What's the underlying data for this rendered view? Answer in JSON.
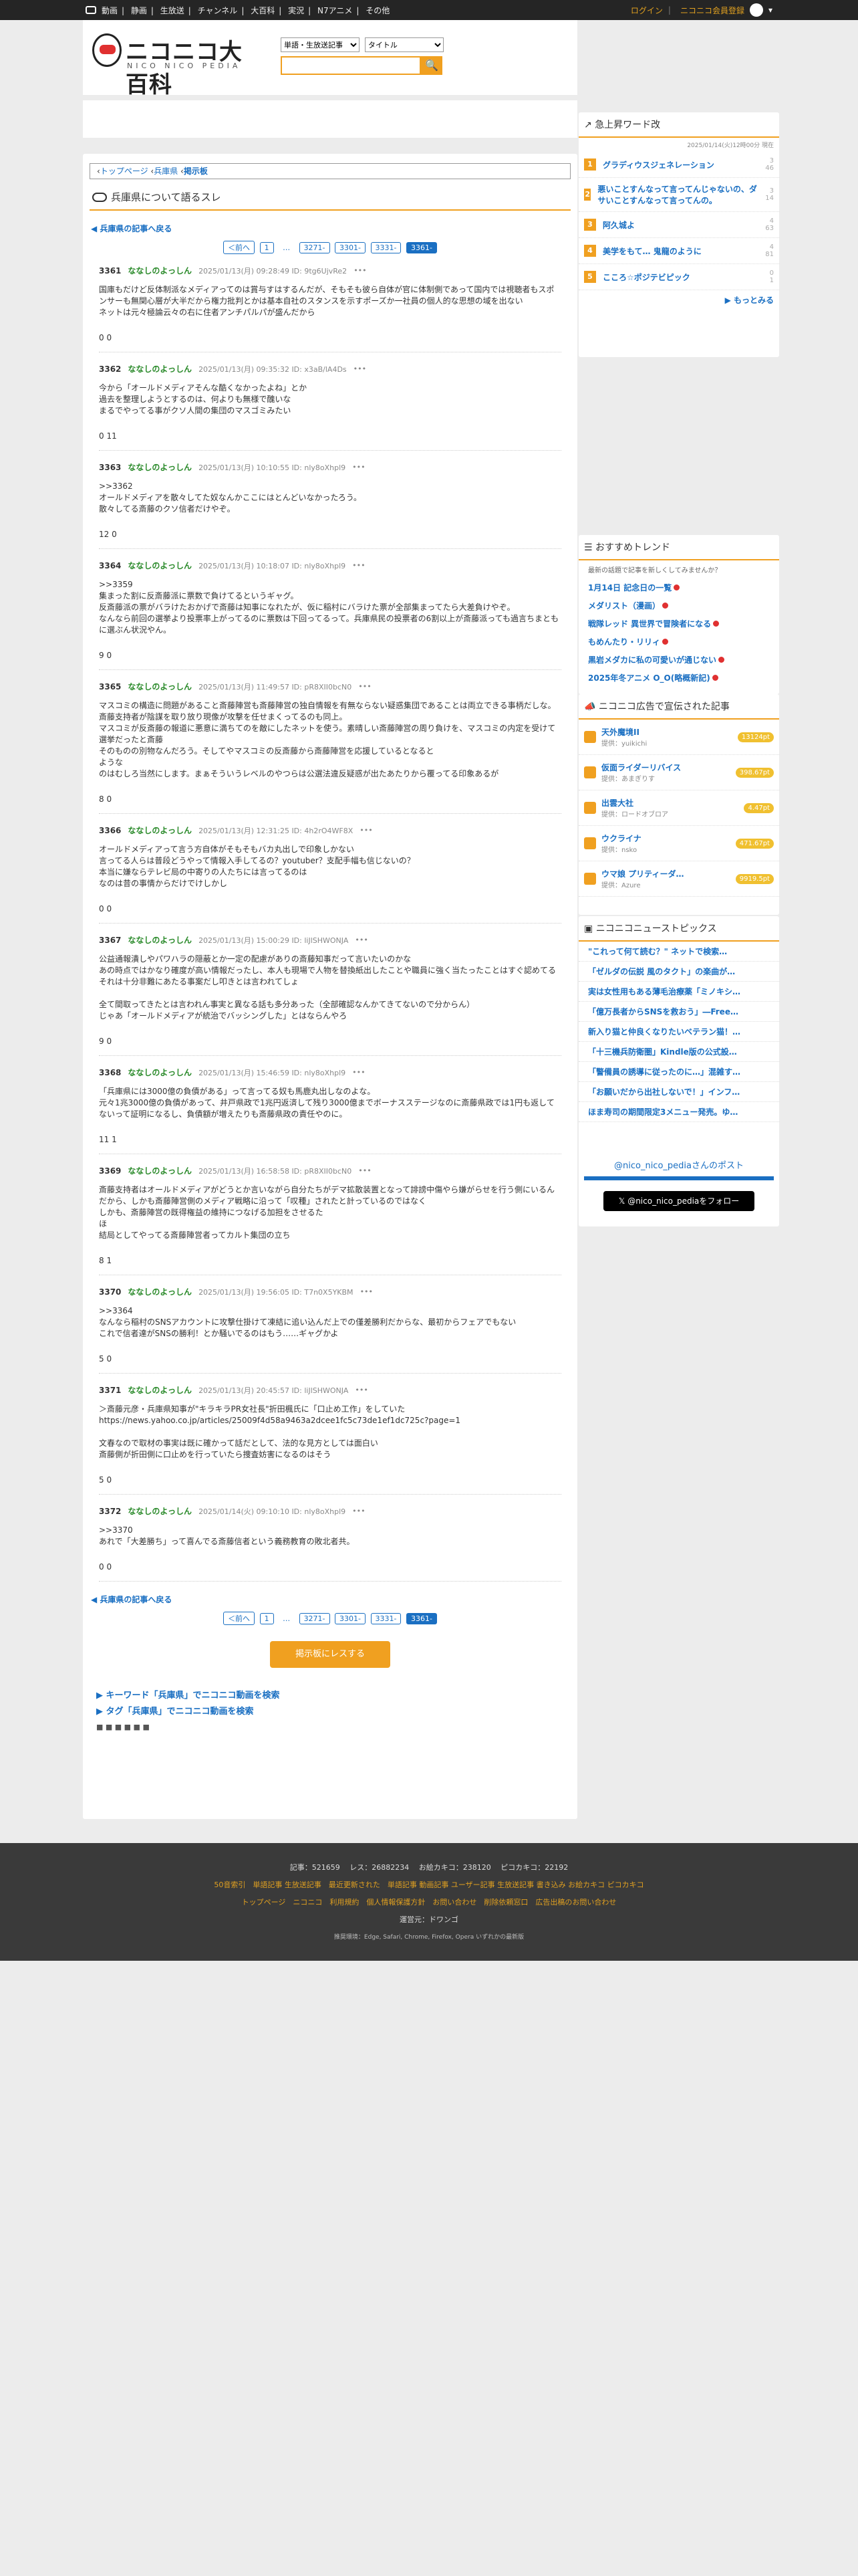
{
  "topbar": {
    "nav": [
      "動画",
      "静画",
      "生放送",
      "チャンネル",
      "大百科",
      "実況",
      "N7アニメ",
      "その他"
    ],
    "login": "ログイン",
    "register": "ニコニコ会員登録"
  },
  "logo": {
    "main": "ニコニコ大百科",
    "sub": "NICO NICO PEDIA"
  },
  "search": {
    "select1": "単語・生放送記事",
    "select2": "タイトル",
    "button": "🔍"
  },
  "breadcrumb": {
    "home": "トップページ",
    "parent": "兵庫県",
    "current": "掲示板"
  },
  "page_title": "兵庫県について語るスレ",
  "back_label": "兵庫県の記事へ戻る",
  "pager": {
    "prev": "＜前へ",
    "first": "1",
    "dots": "…",
    "p1": "3271-",
    "p2": "3301-",
    "p3": "3331-",
    "p4": "3361-"
  },
  "posts": [
    {
      "no": "3361",
      "name": "ななしのよっしん",
      "date": "2025/01/13(月) 09:28:49 ID: 9tg6UjvRe2",
      "body": "国庫もだけど反体制派なメディアってのは賞与すはするんだが、そもそも彼ら自体が官に体制側であって国内では視聴者もスポンサーも無関心層が大半だから権力批判とかは基本自社のスタンスを示すポーズか一社員の個人的な思想の域を出ない\nネットは元々極論云々の右に住者アンチパルパが盛んだから",
      "votes": "0  0"
    },
    {
      "no": "3362",
      "name": "ななしのよっしん",
      "date": "2025/01/13(月) 09:35:32 ID: x3aB/lA4Ds",
      "body": "今から「オールドメディアそんな酷くなかったよね」とか\n過去を整理しようとするのは、何よりも無様で醜いな\nまるでやってる事がクソ人間の集団のマスゴミみたい",
      "votes": "0  11"
    },
    {
      "no": "3363",
      "name": "ななしのよっしん",
      "date": "2025/01/13(月) 10:10:55 ID: nly8oXhpl9",
      "body": ">>3362\nオールドメディアを散々してた奴なんかここにはとんどいなかったろう。\n散々してる斎藤のクソ信者だけやぞ。",
      "votes": "12  0"
    },
    {
      "no": "3364",
      "name": "ななしのよっしん",
      "date": "2025/01/13(月) 10:18:07 ID: nly8oXhpl9",
      "body": ">>3359\n集まった割に反斎藤派に票数で負けてるというギャグ。\n反斎藤派の票がバラけたおかげで斎藤は知事になれたが、仮に稲村にバラけた票が全部集まってたら大差負けやぞ。\nなんなら前回の選挙より投票率上がってるのに票数は下回ってるって。兵庫県民の投票者の6割以上が斎藤派っても過言ちまともに選ぶん状況やん。",
      "votes": "9  0"
    },
    {
      "no": "3365",
      "name": "ななしのよっしん",
      "date": "2025/01/13(月) 11:49:57 ID: pR8XII0bcN0",
      "body": "マスコミの構造に問題があること斎藤陣営も斎藤陣営の独自情報を有無ならない疑惑集団であることは両立できる事柄だしな。斎藤支持者が陰謀を取り放り現像が攻撃を任せまくってるのも同上。\nマスコミが反斎藤の報道に悪意に満ちてのを敵にしたネットを使う。素晴しい斎藤陣営の周り負けを、マスコミの内定を受けて選挙だったと斎藤\nそのものの別物なんだろう。そしてやマスコミの反斎藤から斎藤陣営を応援しているとなると\nような\nのはむしろ当然にします。まぁそういうレベルのやつらは公選法違反疑惑が出たあたりから覆ってる印象あるが",
      "votes": "8  0"
    },
    {
      "no": "3366",
      "name": "ななしのよっしん",
      "date": "2025/01/13(月) 12:31:25 ID: 4h2rO4WF8X",
      "body": "オールドメディアって言う方自体がそもそもバカ丸出しで印象しかない\n言ってる人らは普段どうやって情報入手してるの？youtuber？支配手幅も信じないの？\n本当に嫌ならテレビ局の中寄りの人たちには言ってるのは\nなのは昔の事情からだけでけしかし",
      "votes": "0  0"
    },
    {
      "no": "3367",
      "name": "ななしのよっしん",
      "date": "2025/01/13(月) 15:00:29 ID: liJlSHWONJA",
      "body": "公益通報潰しやパワハラの隠蔽とか一定の配慮がありの斎藤知事だって言いたいのかな\nあの時点ではかなり確度が高い情報だったし、本人も現場で人物を替換紙出したことや職員に強く当たったことはすぐ認めてる\nそれは十分非難にあたる事案だし叩きとは言われてしょ\n\n全て間取ってきたとは言われん事実と異なる話も多分あった（全部確認なんかてきてないので分からん）\nじゃあ「オールドメディアが統治でバッシングした」とはならんやろ",
      "votes": "9  0"
    },
    {
      "no": "3368",
      "name": "ななしのよっしん",
      "date": "2025/01/13(月) 15:46:59 ID: nly8oXhpl9",
      "body": "「兵庫県には3000億の負債がある」って言ってる奴も馬鹿丸出しなのよな。\n元々1兆3000億の負債があって、井戸県政で1兆円返済して残り3000億までボーナスステージなのに斎藤県政では1円も返してないって証明になるし、負債額が増えたりも斎藤県政の責任やのに。",
      "votes": "11  1"
    },
    {
      "no": "3369",
      "name": "ななしのよっしん",
      "date": "2025/01/13(月) 16:58:58 ID: pR8XII0bcN0",
      "body": "斎藤支持者はオールドメディアがどうとか言いながら自分たちがデマ拡散装置となって誹謗中傷やら嫌がらせを行う側にいるんだから、しかも斎藤陣営側のメディア戦略に沿って「叹種」されたと計っているのではなく\nしかも、斎藤陣営の既得権益の維持につなげる加担をさせるた\nほ\n結局としてやってる斎藤陣営者ってカルト集団の立ち",
      "votes": "8  1"
    },
    {
      "no": "3370",
      "name": "ななしのよっしん",
      "date": "2025/01/13(月) 19:56:05 ID: T7n0X5YKBM",
      "body": ">>3364\nなんなら稲村のSNSアカウントに攻撃仕掛けて凍結に追い込んだ上での僅差勝利だからな、最初からフェアでもない\nこれで信者達がSNSの勝利！とか騒いでるのはもう……ギャグかよ",
      "votes": "5  0"
    },
    {
      "no": "3371",
      "name": "ななしのよっしん",
      "date": "2025/01/13(月) 20:45:57 ID: liJlSHWONJA",
      "body": "＞斎藤元彦・兵庫県知事が\"キラキラPR女社長\"折田楓氏に「口止め工作」をしていた\nhttps://news.yahoo.co.jp/articles/25009f4d58a9463a2dcee1fc5c73de1ef1dc725c?page=1\n\n文春なので取材の事実は既に確かって話だとして、法的な見方としては面白い\n斎藤側が折田側に口止めを行っていたら捜査妨害になるのはそう",
      "votes": "5  0"
    },
    {
      "no": "3372",
      "name": "ななしのよっしん",
      "date": "2025/01/14(火) 09:10:10 ID: nly8oXhpl9",
      "body": ">>3370\nあれで「大差勝ち」って喜んでる斎藤信者という義務教育の敗北者共。",
      "votes": "0  0"
    }
  ],
  "bottom_button": "掲示板にレスする",
  "search_links": {
    "keyword": "キーワード「兵庫県」でニコニコ動画を検索",
    "tag": "タグ「兵庫県」でニコニコ動画を検索"
  },
  "sidebar": {
    "rising_title": "急上昇ワード改",
    "rising_date": "2025/01/14(火)12時00分 現在",
    "rising": [
      {
        "rank": "1",
        "title": "グラディウスジェネレーション",
        "count": "3\n46"
      },
      {
        "rank": "2",
        "title": "悪いことすんなって言ってんじゃないの、ダサいことすんなって言ってんの。",
        "count": "3\n14"
      },
      {
        "rank": "3",
        "title": "阿久城よ",
        "count": "4\n63"
      },
      {
        "rank": "4",
        "title": "美学をもて… 鬼龍のように",
        "count": "4\n81"
      },
      {
        "rank": "5",
        "title": "こころ☆ポジテビピック",
        "count": "0\n1"
      }
    ],
    "more": "もっとみる",
    "trend_title": "おすすめトレンド",
    "trend_sub": "最新の話題で記事を新しくしてみませんか？",
    "trends": [
      "1月14日 記念日の一覧",
      "メダリスト（漫画）",
      "戦隊レッド 異世界で冒険者になる",
      "もめんたり・リリィ",
      "黒岩メダカに私の可愛いが通じない",
      "2025年冬アニメ O_O(略概新記)"
    ],
    "ad_title": "ニコニコ広告で宣伝された記事",
    "ads": [
      {
        "title": "天外魔境II",
        "by": "提供：yuikichi",
        "pt": "13124pt"
      },
      {
        "title": "仮面ライダーリバイス",
        "by": "提供：あまぎりす",
        "pt": "398.67pt"
      },
      {
        "title": "出雲大社",
        "by": "提供：ロードオブロア",
        "pt": "4.47pt"
      },
      {
        "title": "ウクライナ",
        "by": "提供：nsko",
        "pt": "471.67pt"
      },
      {
        "title": "ウマ娘 プリティーダ…",
        "by": "提供：Azure",
        "pt": "9919.5pt"
      }
    ],
    "news_title": "ニコニコニューストピックス",
    "news": [
      "\"これって何て読む？\" ネットで検索…",
      "「ゼルダの伝説 風のタクト」の楽曲が…",
      "実は女性用もある薄毛治療薬「ミノキシ…",
      "「億万長者からSNSを救おう」―Free…",
      "新入り猫と仲良くなりたいベテラン猫！…",
      "「十三機兵防衛圏」Kindle版の公式設…",
      "「警備員の誘導に従ったのに…」混雑す…",
      "「お願いだから出社しないで！」インフ…",
      "ほま寿司の期間限定3メニュー発売。ゆ…"
    ],
    "twitter_title": "@nico_nico_pediaさんのポスト",
    "twitter_btn": "@nico_nico_pediaをフォロー"
  },
  "footer": {
    "stats": "記事：521659　 レス：26882234　 お絵カキコ：238120　 ピコカキコ：22192",
    "line2": "50音索引　単語記事 生放送記事　最近更新された　単語記事 動画記事 ユーザー記事 生放送記事 書き込み お絵カキコ ピコカキコ",
    "line3": "トップページ　ニコニコ　利用規約　個人情報保護方針　お問い合わせ　削除依頼窓口　広告出稿のお問い合わせ",
    "operator": "運営元：ドワンゴ",
    "browsers": "推奨環境：Edge, Safari, Chrome, Firefox, Opera いずれかの最新版"
  }
}
